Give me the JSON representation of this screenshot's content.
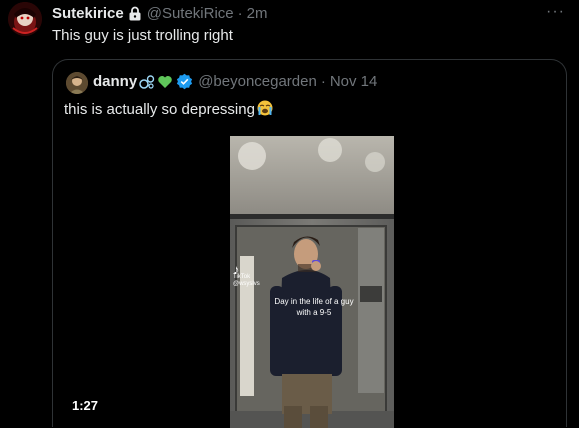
{
  "tweet": {
    "display_name": "Sutekirice",
    "handle": "@SutekiRice",
    "separator": "·",
    "time": "2m",
    "text": "This guy is just trolling right",
    "more_icon": "more-horizontal-icon",
    "lock_icon": "lock-icon"
  },
  "quote": {
    "display_name": "danny",
    "name_emojis": [
      "bubbles-emoji",
      "green-heart-emoji"
    ],
    "verified_icon": "verified-badge-icon",
    "handle": "@beyoncegarden",
    "separator": "·",
    "date": "Nov 14",
    "text": "this is actually so depressing",
    "text_emoji": "loudly-crying-face-emoji"
  },
  "video": {
    "duration": "1:27",
    "watermark_brand": "TikTok",
    "watermark_user": "@wsyslvs",
    "caption": "Day in the life of a guy with a 9-5"
  },
  "colors": {
    "background": "#000000",
    "text_primary": "#e7e9ea",
    "text_secondary": "#71767b",
    "border": "#2f3336",
    "verified_blue": "#1d9bf0"
  }
}
